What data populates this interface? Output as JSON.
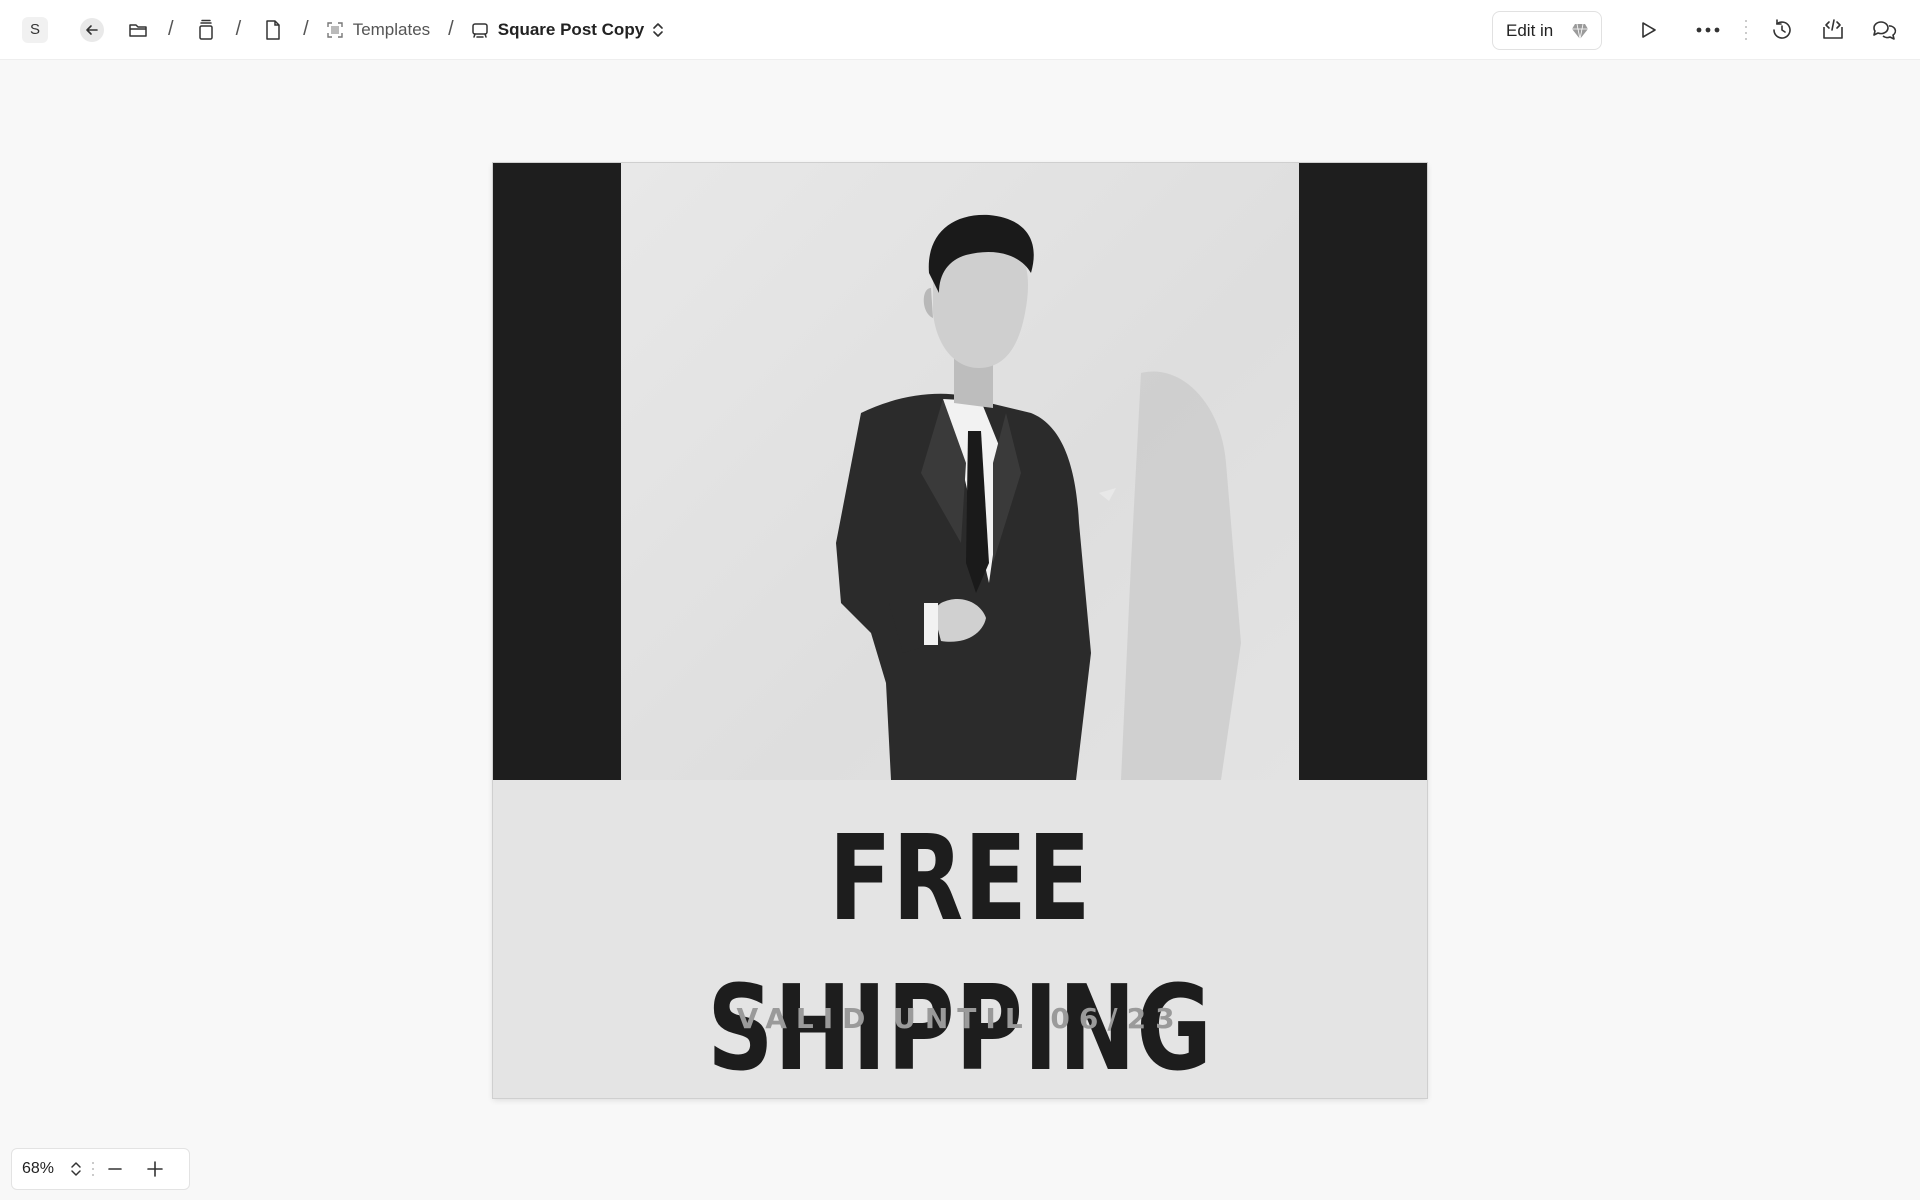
{
  "topbar": {
    "avatar_letter": "S",
    "breadcrumb": {
      "items": [
        {
          "icon": "folder-icon",
          "label": ""
        },
        {
          "icon": "stack-icon",
          "label": ""
        },
        {
          "icon": "file-icon",
          "label": ""
        },
        {
          "icon": "frame-icon",
          "label": "Templates"
        },
        {
          "icon": "component-icon",
          "label": "Square Post Copy"
        }
      ],
      "separator": "/"
    },
    "edit_in_label": "Edit in",
    "edit_in_icon": "sketch-gem-icon"
  },
  "artboard": {
    "headline": "FREE SHIPPING",
    "subline": "VALID UNTIL 06/23",
    "colors": {
      "band": "#1e1e1e",
      "background": "#e4e4e4",
      "headline": "#1d1d1d",
      "subline": "#9a9a9a"
    }
  },
  "zoom": {
    "value": "68%"
  }
}
